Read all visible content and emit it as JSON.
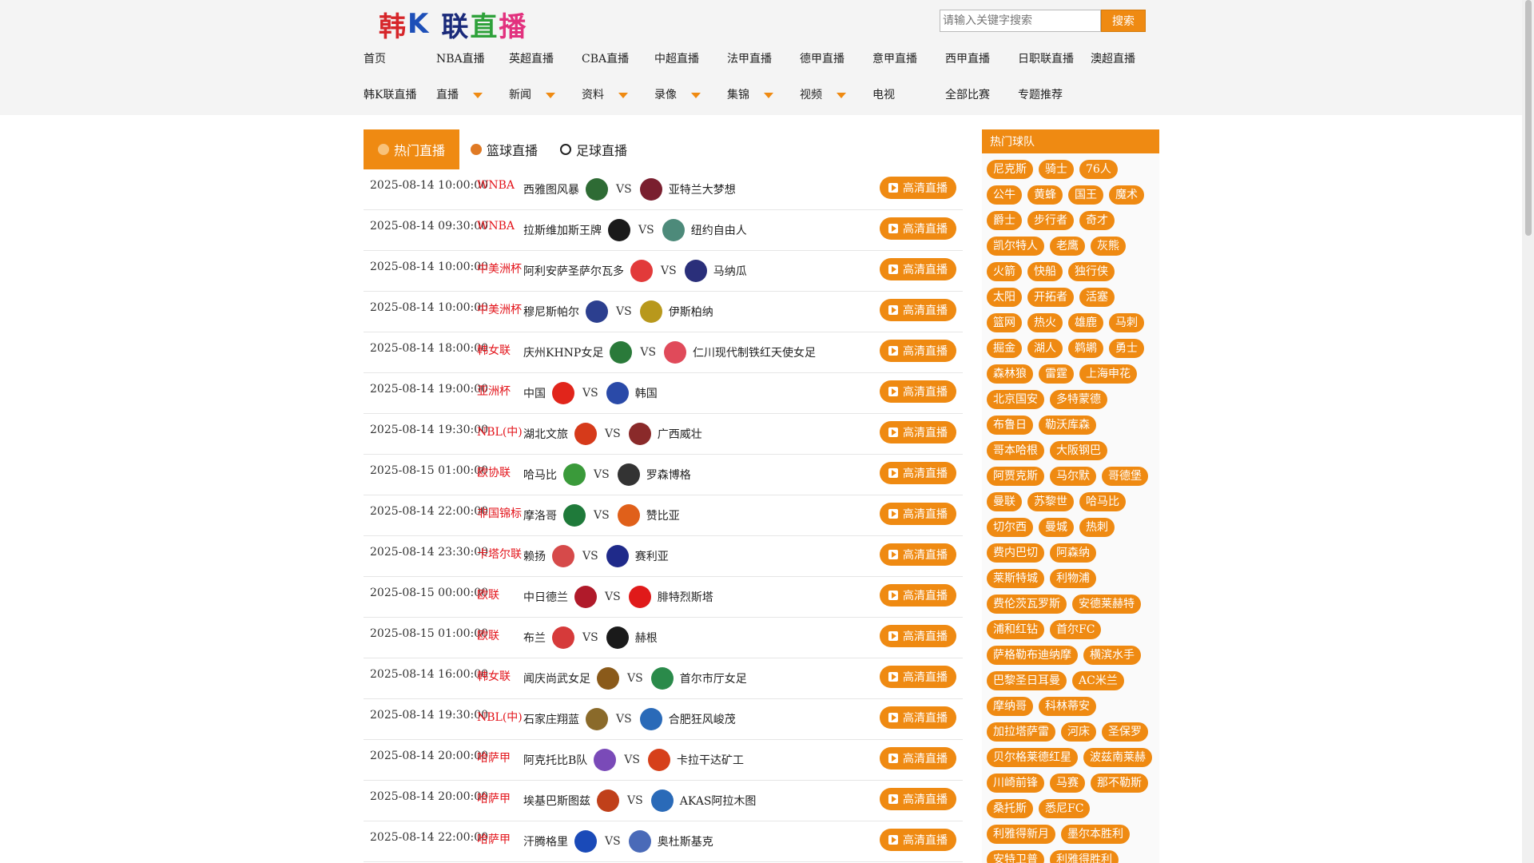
{
  "logo": {
    "c1": "韩",
    "c2": "K",
    "c3": "联",
    "c4": "直",
    "c5": "播"
  },
  "search": {
    "placeholder": "请输入关键字搜索",
    "button": "搜索"
  },
  "nav": {
    "row1": [
      "首页",
      "NBA直播",
      "英超直播",
      "CBA直播",
      "中超直播",
      "法甲直播",
      "德甲直播",
      "意甲直播",
      "西甲直播",
      "日职联直播",
      "澳超直播"
    ],
    "row2": [
      {
        "label": "韩K联直播",
        "dropdown": false
      },
      {
        "label": "直播",
        "dropdown": true
      },
      {
        "label": "新闻",
        "dropdown": true
      },
      {
        "label": "资料",
        "dropdown": true
      },
      {
        "label": "录像",
        "dropdown": true
      },
      {
        "label": "集锦",
        "dropdown": true
      },
      {
        "label": "视频",
        "dropdown": true
      },
      {
        "label": "电视",
        "dropdown": false
      },
      {
        "label": "全部比赛",
        "dropdown": false
      },
      {
        "label": "专题推荐",
        "dropdown": false
      }
    ]
  },
  "tabs": [
    "热门直播",
    "篮球直播",
    "足球直播"
  ],
  "vs_label": "VS",
  "watch_label": "高清直播",
  "matches": [
    {
      "time": "2025-08-14 10:00:00",
      "league": "WNBA",
      "home": "西雅图风暴",
      "away": "亚特兰大梦想",
      "hc": "#2e6b34",
      "ac": "#7a1f2f"
    },
    {
      "time": "2025-08-14 09:30:00",
      "league": "WNBA",
      "home": "拉斯维加斯王牌",
      "away": "纽约自由人",
      "hc": "#1a1a1a",
      "ac": "#4d8a7a"
    },
    {
      "time": "2025-08-14 10:00:00",
      "league": "中美洲杯",
      "home": "阿利安萨圣萨尔瓦多",
      "away": "马纳瓜",
      "hc": "#e23a3a",
      "ac": "#2a2f7a"
    },
    {
      "time": "2025-08-14 10:00:00",
      "league": "中美洲杯",
      "home": "穆尼斯帕尔",
      "away": "伊斯柏纳",
      "hc": "#2c3f8f",
      "ac": "#b8981c"
    },
    {
      "time": "2025-08-14 18:00:00",
      "league": "韩女联",
      "home": "庆州KHNP女足",
      "away": "仁川现代制铁红天使女足",
      "hc": "#2a7a3a",
      "ac": "#e04a5a"
    },
    {
      "time": "2025-08-14 19:00:00",
      "league": "亚洲杯",
      "home": "中国",
      "away": "韩国",
      "hc": "#e1251b",
      "ac": "#2a4aa8"
    },
    {
      "time": "2025-08-14 19:30:00",
      "league": "NBL(中)",
      "home": "湖北文旅",
      "away": "广西威壮",
      "hc": "#d63a1a",
      "ac": "#8a2a2a"
    },
    {
      "time": "2025-08-15 01:00:00",
      "league": "欧协联",
      "home": "哈马比",
      "away": "罗森博格",
      "hc": "#3a9a3a",
      "ac": "#333333"
    },
    {
      "time": "2025-08-14 22:00:00",
      "league": "非国锦标",
      "home": "摩洛哥",
      "away": "赞比亚",
      "hc": "#1f7a3a",
      "ac": "#e0601a"
    },
    {
      "time": "2025-08-14 23:30:00",
      "league": "卡塔尔联",
      "home": "赖扬",
      "away": "赛利亚",
      "hc": "#d64a4a",
      "ac": "#1f2a8a"
    },
    {
      "time": "2025-08-15 00:00:00",
      "league": "欧联",
      "home": "中日德兰",
      "away": "腓特烈斯塔",
      "hc": "#b01a2a",
      "ac": "#e01a1a"
    },
    {
      "time": "2025-08-15 01:00:00",
      "league": "欧联",
      "home": "布兰",
      "away": "赫根",
      "hc": "#d63a3a",
      "ac": "#1a1a1a"
    },
    {
      "time": "2025-08-14 16:00:00",
      "league": "韩女联",
      "home": "闻庆尚武女足",
      "away": "首尔市厅女足",
      "hc": "#8a5a1a",
      "ac": "#2a8a4a"
    },
    {
      "time": "2025-08-14 19:30:00",
      "league": "NBL(中)",
      "home": "石家庄翔蓝",
      "away": "合肥狂风峻茂",
      "hc": "#8a6a2a",
      "ac": "#2a6ab8"
    },
    {
      "time": "2025-08-14 20:00:00",
      "league": "哈萨甲",
      "home": "阿克托比B队",
      "away": "卡拉干达矿工",
      "hc": "#7a4ab8",
      "ac": "#d6401a"
    },
    {
      "time": "2025-08-14 20:00:00",
      "league": "哈萨甲",
      "home": "埃基巴斯图兹",
      "away": "AKAS阿拉木图",
      "hc": "#c0401a",
      "ac": "#2a6ab8"
    },
    {
      "time": "2025-08-14 22:00:00",
      "league": "哈萨甲",
      "home": "汗腾格里",
      "away": "奥杜斯基克",
      "hc": "#1a4ab8",
      "ac": "#4a6ab8"
    }
  ],
  "sidebar": {
    "title": "热门球队",
    "teams": [
      "尼克斯",
      "骑士",
      "76人",
      "公牛",
      "黄蜂",
      "国王",
      "魔术",
      "爵士",
      "步行者",
      "奇才",
      "凯尔特人",
      "老鹰",
      "灰熊",
      "火箭",
      "快船",
      "独行侠",
      "太阳",
      "开拓者",
      "活塞",
      "篮网",
      "热火",
      "雄鹿",
      "马刺",
      "掘金",
      "湖人",
      "鹈鹕",
      "勇士",
      "森林狼",
      "雷霆",
      "上海申花",
      "北京国安",
      "多特蒙德",
      "布鲁日",
      "勒沃库森",
      "哥本哈根",
      "大阪钢巴",
      "阿贾克斯",
      "马尔默",
      "哥德堡",
      "曼联",
      "苏黎世",
      "哈马比",
      "切尔西",
      "曼城",
      "热刺",
      "费内巴切",
      "阿森纳",
      "莱斯特城",
      "利物浦",
      "费伦茨瓦罗斯",
      "安德莱赫特",
      "浦和红钻",
      "首尔FC",
      "萨格勒布迪纳摩",
      "横滨水手",
      "巴黎圣日耳曼",
      "AC米兰",
      "摩纳哥",
      "科林蒂安",
      "加拉塔萨雷",
      "河床",
      "圣保罗",
      "贝尔格莱德红星",
      "波兹南莱赫",
      "川崎前锋",
      "马赛",
      "那不勒斯",
      "桑托斯",
      "悉尼FC",
      "利雅得新月",
      "墨尔本胜利",
      "安特卫普",
      "利雅得胜利"
    ]
  }
}
